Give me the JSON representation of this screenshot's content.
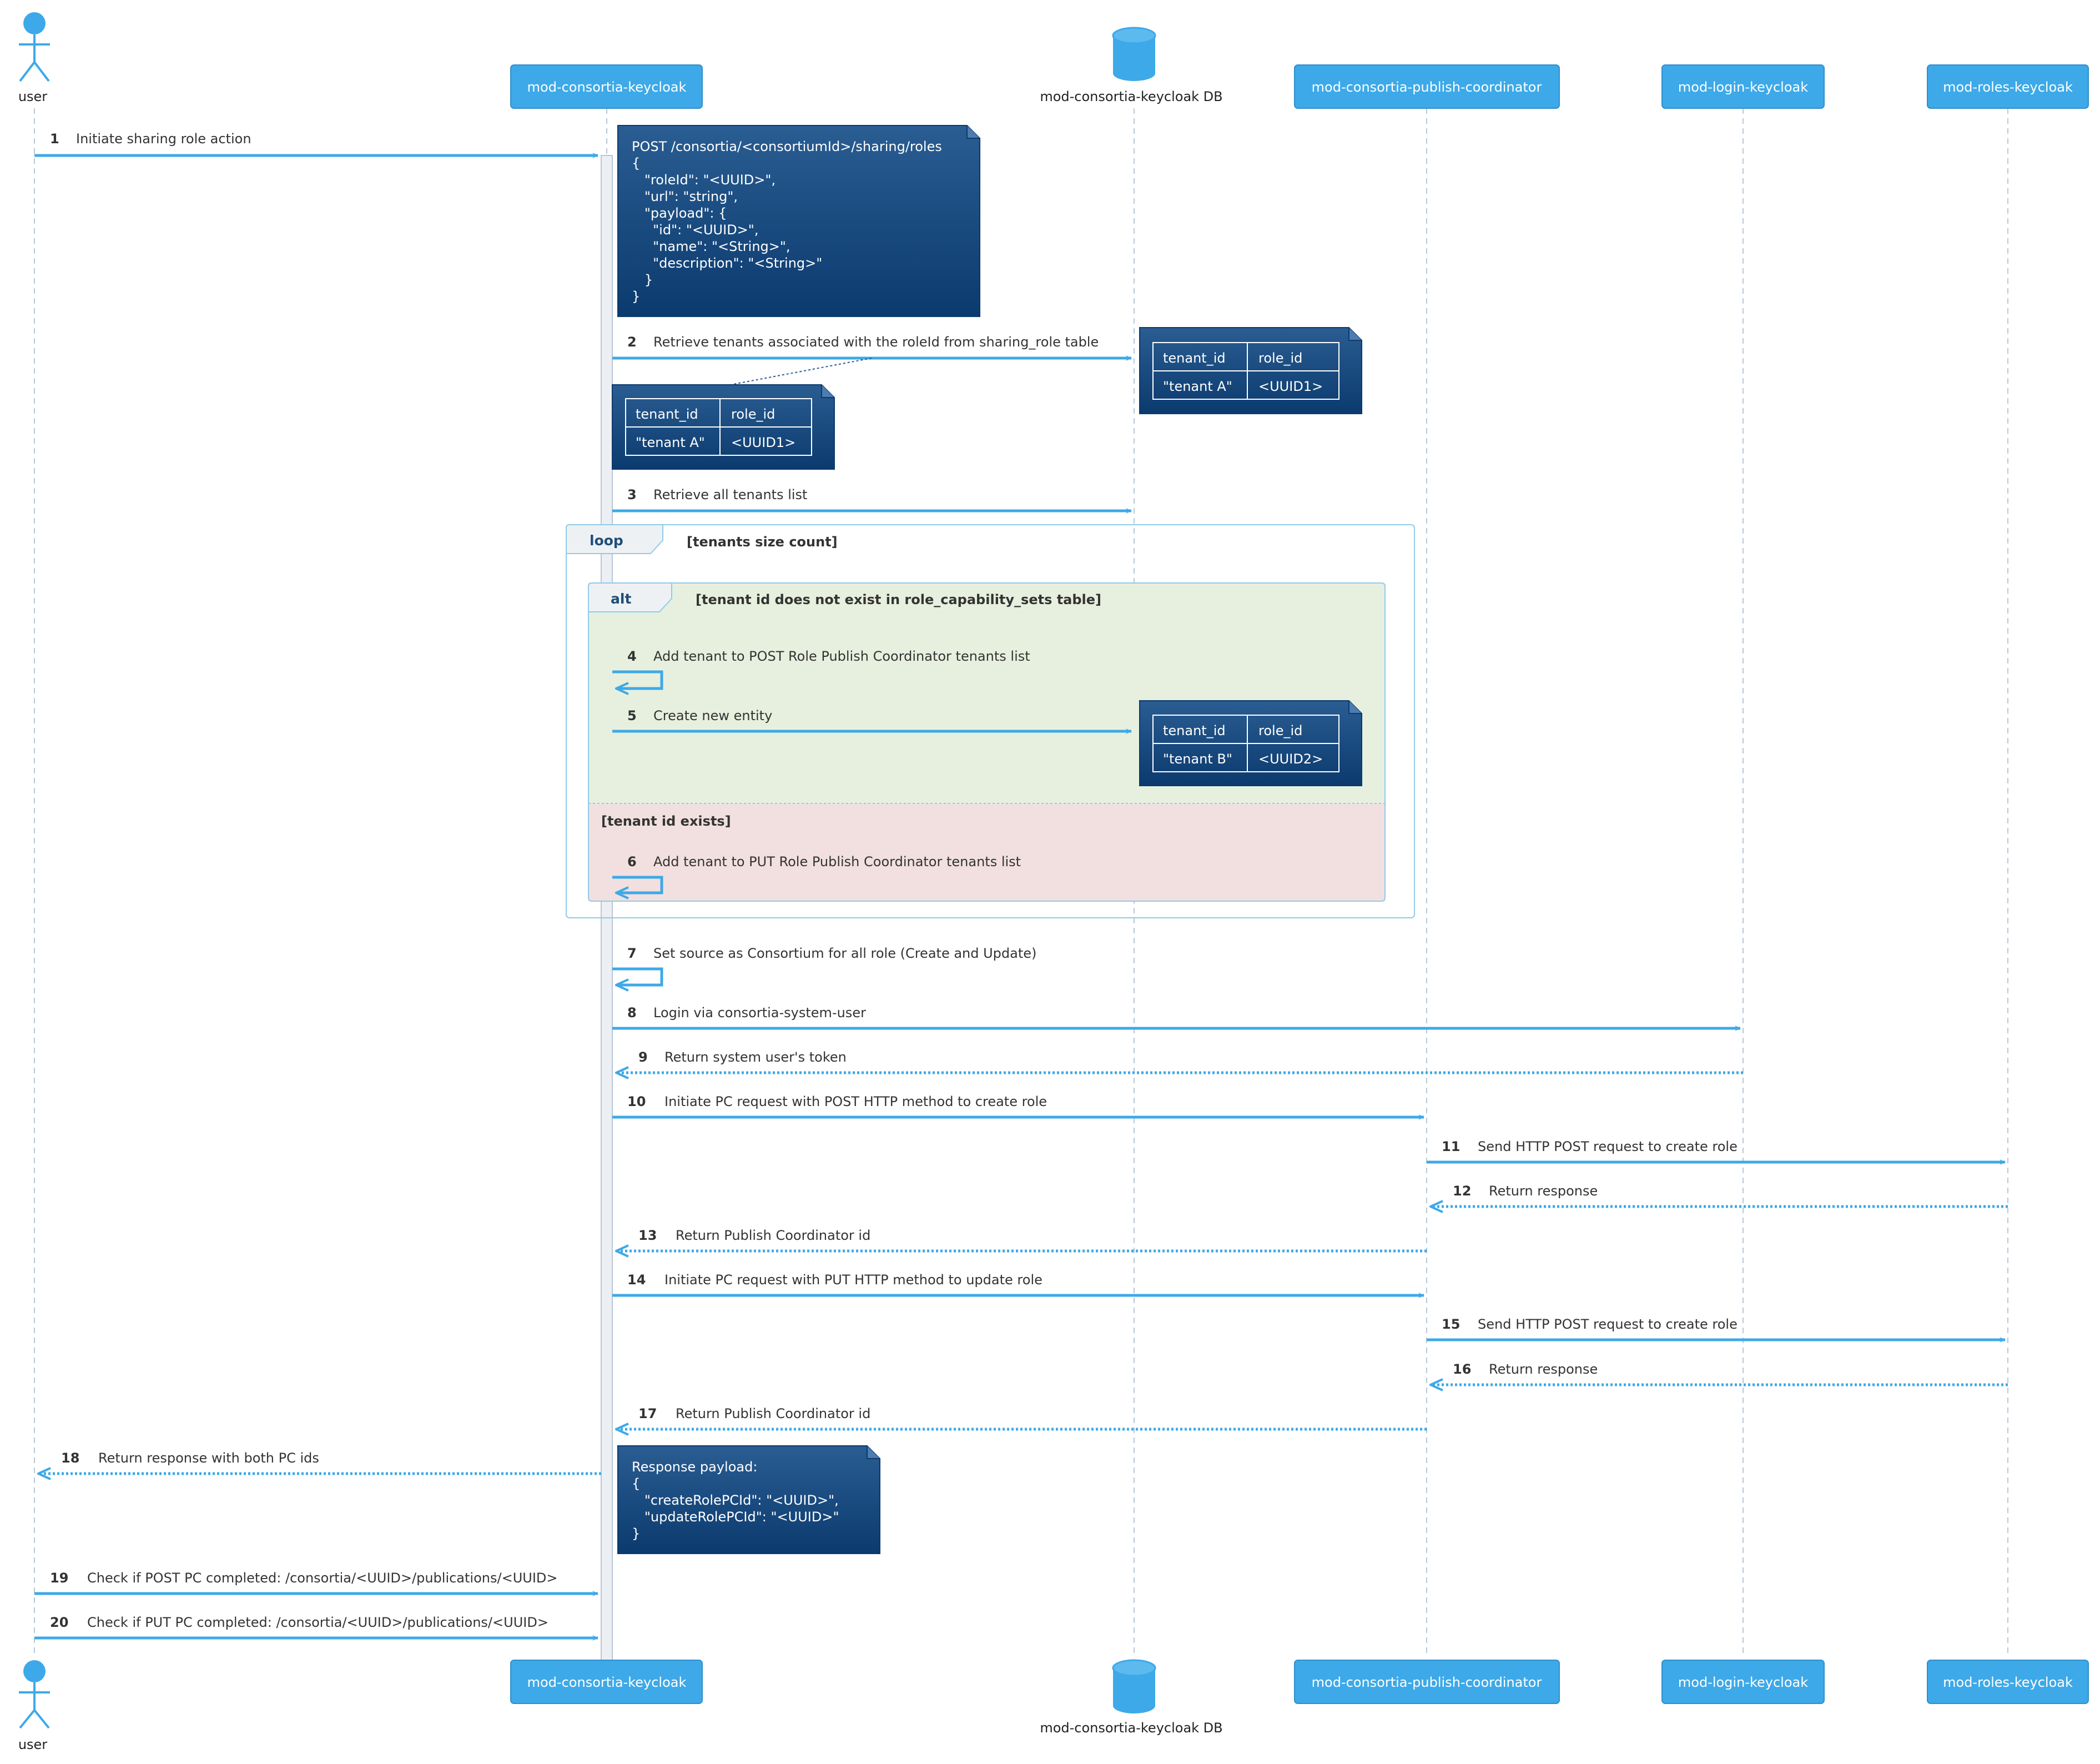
{
  "participants": {
    "user": "user",
    "keycloak": "mod-consortia-keycloak",
    "db": "mod-consortia-keycloak DB",
    "publish": "mod-consortia-publish-coordinator",
    "login": "mod-login-keycloak",
    "roles": "mod-roles-keycloak"
  },
  "colors": {
    "accent": "#3DA9E8",
    "note_top": "#2A5D92",
    "note_bottom": "#0B3A6E",
    "alt_green": "#E7F0DE",
    "alt_pink": "#F2E0E0"
  },
  "messages": [
    {
      "n": "1",
      "text": "Initiate sharing role action"
    },
    {
      "n": "2",
      "text": "Retrieve tenants associated with the roleId from sharing_role table"
    },
    {
      "n": "3",
      "text": "Retrieve all tenants list"
    },
    {
      "n": "4",
      "text": "Add tenant to POST Role Publish Coordinator tenants list"
    },
    {
      "n": "5",
      "text": "Create new entity"
    },
    {
      "n": "6",
      "text": "Add tenant to PUT Role Publish Coordinator tenants list"
    },
    {
      "n": "7",
      "text": "Set source as Consortium for all role (Create and Update)"
    },
    {
      "n": "8",
      "text": "Login via consortia-system-user"
    },
    {
      "n": "9",
      "text": "Return system user's token"
    },
    {
      "n": "10",
      "text": "Initiate PC request with POST HTTP method to create role"
    },
    {
      "n": "11",
      "text": "Send HTTP POST request to create role"
    },
    {
      "n": "12",
      "text": "Return response"
    },
    {
      "n": "13",
      "text": "Return Publish Coordinator id"
    },
    {
      "n": "14",
      "text": "Initiate PC request with PUT HTTP method to update role"
    },
    {
      "n": "15",
      "text": "Send HTTP POST request to create role"
    },
    {
      "n": "16",
      "text": "Return response"
    },
    {
      "n": "17",
      "text": "Return Publish Coordinator id"
    },
    {
      "n": "18",
      "text": "Return response with both PC ids"
    },
    {
      "n": "19",
      "text": "Check if POST PC completed: /consortia/<UUID>/publications/<UUID>"
    },
    {
      "n": "20",
      "text": "Check if PUT PC completed: /consortia/<UUID>/publications/<UUID>"
    }
  ],
  "notes": {
    "request": [
      "POST /consortia/<consortiumId>/sharing/roles",
      "{",
      "   \"roleId\": \"<UUID>\",",
      "   \"url\": \"string\",",
      "   \"payload\": {",
      "     \"id\": \"<UUID>\",",
      "     \"name\": \"<String>\",",
      "     \"description\": \"<String>\"",
      "   }",
      "}"
    ],
    "response": [
      "Response payload:",
      "{",
      "   \"createRolePCId\": \"<UUID>\",",
      "   \"updateRolePCId\": \"<UUID>\"",
      "}"
    ]
  },
  "tables": {
    "header": [
      "tenant_id",
      "role_id"
    ],
    "db_row_1": [
      "\"tenant A\"",
      "<UUID1>"
    ],
    "side_row": [
      "\"tenant A\"",
      "<UUID1>"
    ],
    "db_row_2": [
      "\"tenant B\"",
      "<UUID2>"
    ]
  },
  "fragments": {
    "loop_keyword": "loop",
    "loop_guard": "[tenants size count]",
    "alt_keyword": "alt",
    "alt_guard": "[tenant id does not exist in role_capability_sets table]",
    "else_guard": "[tenant id exists]"
  }
}
